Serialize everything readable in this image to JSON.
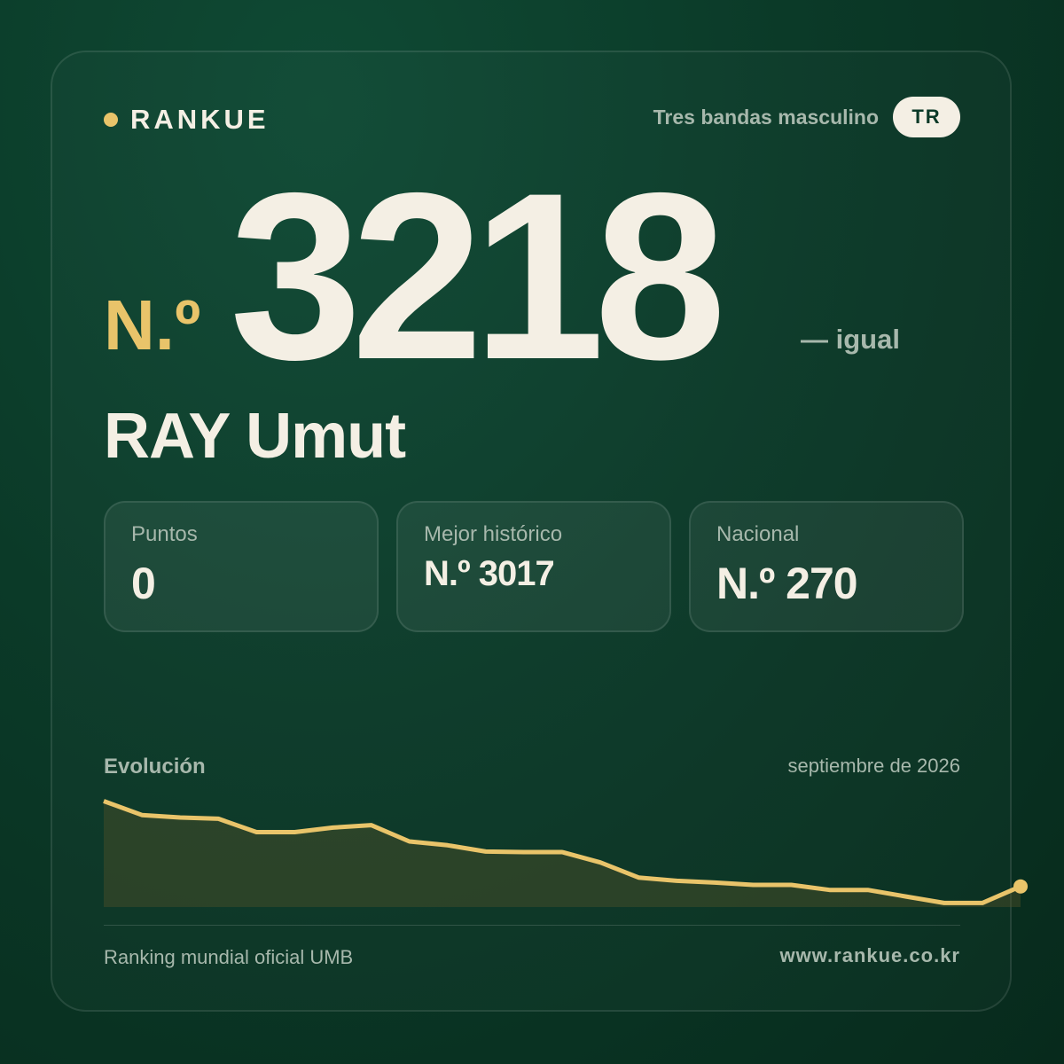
{
  "colors": {
    "accent": "#e9c46a",
    "text_primary": "#f4efe4",
    "text_muted": "#a7b8ac",
    "background": "#0b3a28"
  },
  "brand": {
    "name": "RANKUE"
  },
  "category": {
    "label": "Tres bandas masculino",
    "country_code": "TR"
  },
  "rank": {
    "prefix": "N.º",
    "value": "3218",
    "change": "— igual"
  },
  "player": {
    "name": "RAY Umut"
  },
  "stats": [
    {
      "label": "Puntos",
      "value": "0"
    },
    {
      "label": "Mejor histórico",
      "value": "N.º 3017"
    },
    {
      "label": "Nacional",
      "value": "N.º 270"
    }
  ],
  "evolution": {
    "title": "Evolución",
    "date": "septiembre de 2026"
  },
  "chart_data": {
    "type": "area",
    "title": "Evolución",
    "xlabel": "",
    "ylabel": "",
    "inverted_rank": true,
    "values": [
      2880,
      2935,
      2945,
      2950,
      3003,
      3003,
      2985,
      2975,
      3040,
      3055,
      3080,
      3082,
      3082,
      3123,
      3183,
      3196,
      3203,
      3212,
      3212,
      3232,
      3232,
      3258,
      3284,
      3284,
      3218
    ],
    "ylim": [
      2850,
      3300
    ],
    "grid": false,
    "legend": "none"
  },
  "footer": {
    "left": "Ranking mundial oficial UMB",
    "right": "www.rankue.co.kr"
  }
}
